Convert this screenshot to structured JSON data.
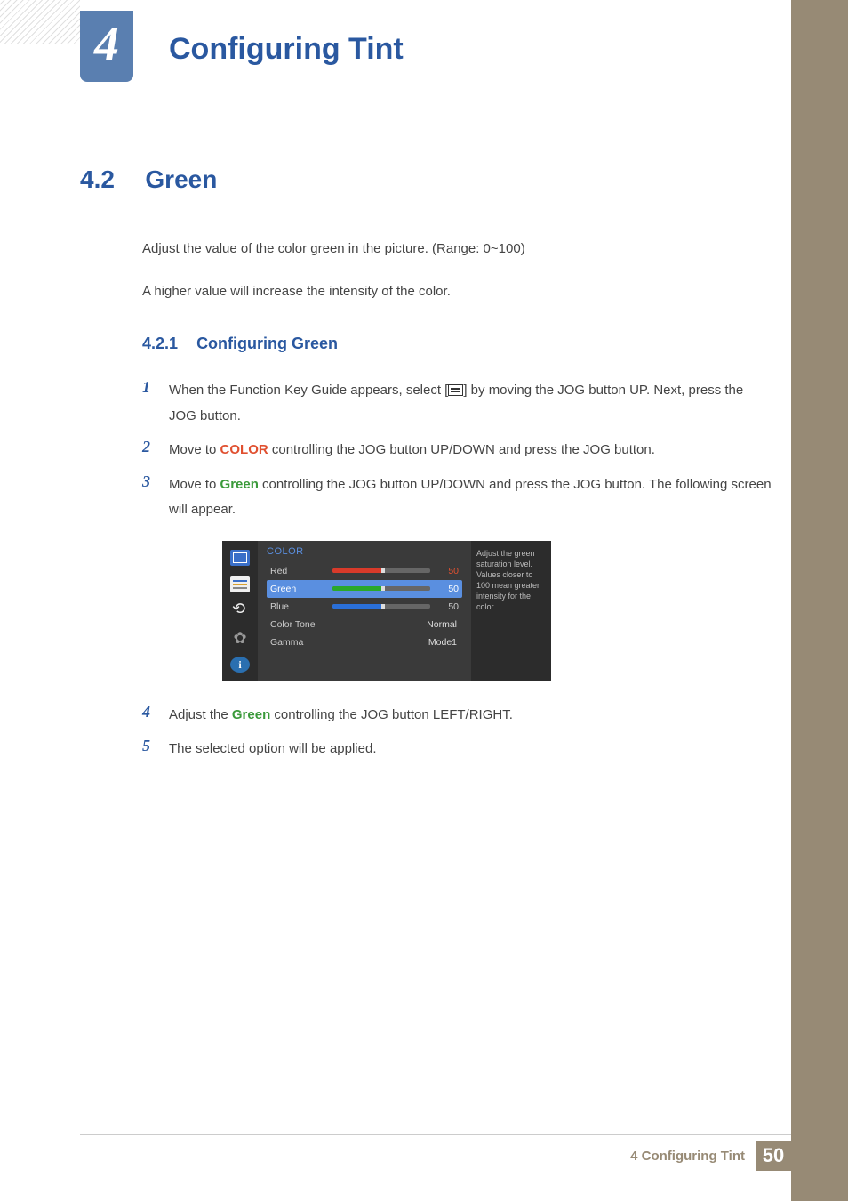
{
  "chapter": {
    "number": "4",
    "title": "Configuring Tint"
  },
  "section": {
    "number": "4.2",
    "title": "Green"
  },
  "intro": {
    "p1": "Adjust the value of the color green in the picture. (Range: 0~100)",
    "p2": "A higher value will increase the intensity of the color."
  },
  "subsection": {
    "number": "4.2.1",
    "title": "Configuring Green"
  },
  "steps": {
    "s1": {
      "num": "1",
      "a": "When the Function Key Guide appears, select [",
      "b": "] by moving the JOG button UP. Next, press the JOG button."
    },
    "s2": {
      "num": "2",
      "a": "Move to ",
      "hl": "COLOR",
      "b": " controlling the JOG button UP/DOWN and press the JOG button."
    },
    "s3": {
      "num": "3",
      "a": "Move to ",
      "hl": "Green",
      "b": " controlling the JOG button UP/DOWN and press the JOG button. The following screen will appear."
    },
    "s4": {
      "num": "4",
      "a": "Adjust the ",
      "hl": "Green",
      "b": " controlling the JOG button LEFT/RIGHT."
    },
    "s5": {
      "num": "5",
      "a": "The selected option will be applied."
    }
  },
  "osd": {
    "title": "COLOR",
    "rows": {
      "red": {
        "label": "Red",
        "value": "50",
        "fill": "#d83a2a",
        "pct": 50
      },
      "green": {
        "label": "Green",
        "value": "50",
        "fill": "#2aa82a",
        "pct": 50
      },
      "blue": {
        "label": "Blue",
        "value": "50",
        "fill": "#2a6fd8",
        "pct": 50
      },
      "tone": {
        "label": "Color Tone",
        "value": "Normal"
      },
      "gamma": {
        "label": "Gamma",
        "value": "Mode1"
      }
    },
    "help": "Adjust the green saturation level. Values closer to 100 mean greater intensity for the color.",
    "info_glyph": "i",
    "gear_glyph": "✿"
  },
  "footer": {
    "label": "4 Configuring Tint",
    "page": "50"
  }
}
